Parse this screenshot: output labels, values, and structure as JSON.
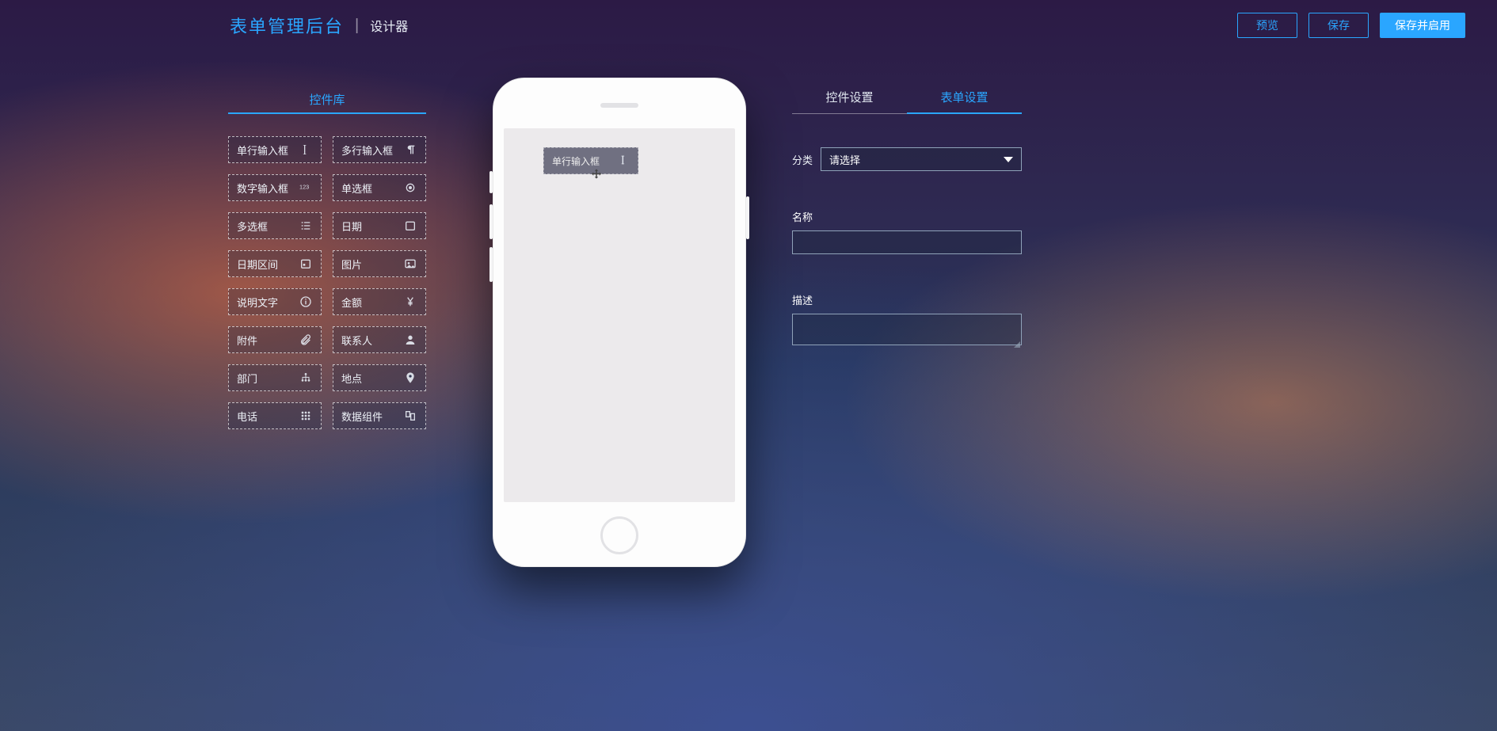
{
  "header": {
    "brand": "表单管理后台",
    "subtitle": "设计器",
    "actions": {
      "preview": "预览",
      "save": "保存",
      "save_enable": "保存并启用"
    }
  },
  "palette": {
    "title": "控件库",
    "items": [
      {
        "label": "单行输入框",
        "icon": "text-cursor"
      },
      {
        "label": "多行输入框",
        "icon": "paragraph"
      },
      {
        "label": "数字输入框",
        "icon": "digits"
      },
      {
        "label": "单选框",
        "icon": "radio"
      },
      {
        "label": "多选框",
        "icon": "checklist"
      },
      {
        "label": "日期",
        "icon": "calendar"
      },
      {
        "label": "日期区间",
        "icon": "calendar-range"
      },
      {
        "label": "图片",
        "icon": "image"
      },
      {
        "label": "说明文字",
        "icon": "info"
      },
      {
        "label": "金额",
        "icon": "yen"
      },
      {
        "label": "附件",
        "icon": "paperclip"
      },
      {
        "label": "联系人",
        "icon": "person"
      },
      {
        "label": "部门",
        "icon": "org"
      },
      {
        "label": "地点",
        "icon": "pin"
      },
      {
        "label": "电话",
        "icon": "dialpad"
      },
      {
        "label": "数据组件",
        "icon": "dataset"
      }
    ]
  },
  "canvas": {
    "dragging_label": "单行输入框"
  },
  "props": {
    "tabs": {
      "widget": "控件设置",
      "form": "表单设置"
    },
    "active_tab": "form",
    "category_label": "分类",
    "category_placeholder": "请选择",
    "name_label": "名称",
    "name_value": "",
    "desc_label": "描述",
    "desc_value": ""
  }
}
